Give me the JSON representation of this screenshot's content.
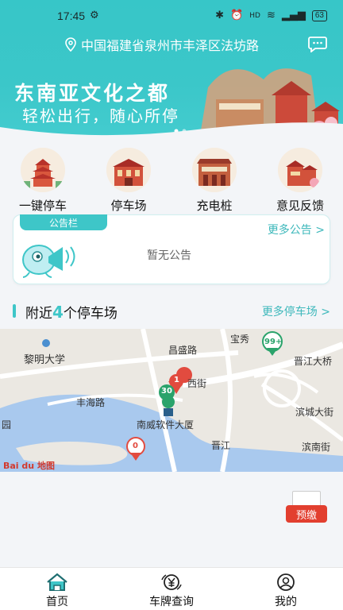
{
  "status": {
    "time": "17:45",
    "battery": "63",
    "signal": "HD"
  },
  "header": {
    "location": "中国福建省泉州市丰泽区法坊路",
    "banner_title": "东南亚文化之都",
    "banner_subtitle": "轻松出行，随心所停",
    "colors": {
      "primary": "#3ec6c8",
      "accent_red": "#e23f2f"
    }
  },
  "quick_menu": [
    {
      "label": "一键停车",
      "icon": "pagoda-icon"
    },
    {
      "label": "停车场",
      "icon": "parking-building-icon"
    },
    {
      "label": "充电桩",
      "icon": "charging-building-icon"
    },
    {
      "label": "意见反馈",
      "icon": "feedback-building-icon"
    }
  ],
  "notice": {
    "tab": "公告栏",
    "more": "更多公告 >",
    "empty": "暂无公告"
  },
  "nearby": {
    "prefix": "附近",
    "count": "4",
    "suffix": "个停车场",
    "more": "更多停车场 >"
  },
  "map": {
    "labels": [
      "宝秀",
      "昌盛路",
      "黎明大学",
      "晋江大桥",
      "西街",
      "丰海路",
      "南威软件大厦",
      "滨城大街",
      "滨南街",
      "晋江",
      "园"
    ],
    "markers": [
      "99+",
      "1",
      "30",
      "0"
    ],
    "logo": "Bai du 地图"
  },
  "pay": {
    "label": "预缴"
  },
  "bottom_nav": [
    {
      "label": "首页",
      "icon": "home-icon"
    },
    {
      "label": "车牌查询",
      "icon": "yen-plate-icon"
    },
    {
      "label": "我的",
      "icon": "user-icon"
    }
  ]
}
